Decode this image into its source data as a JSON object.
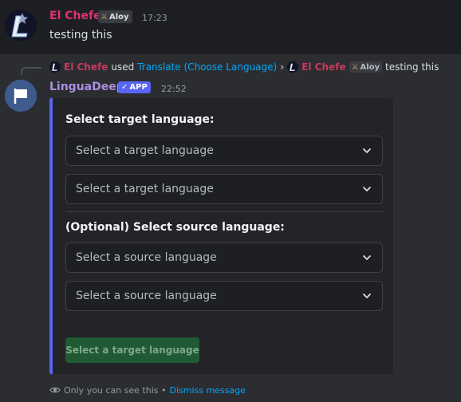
{
  "message": {
    "author": "El Chefe",
    "author_color": "#e0316e",
    "tag": "Aloy",
    "time": "17:23",
    "text": "testing this"
  },
  "reply": {
    "author": "El Chefe",
    "used_text": "used",
    "command": "Translate (Choose Language)",
    "separator": "›",
    "tag_author": "El Chefe",
    "tag": "Aloy",
    "text": "testing this"
  },
  "bot": {
    "name": "LinguaDeep",
    "name_color": "#a98fe0",
    "badge": "APP",
    "time": "22:52"
  },
  "embed": {
    "accent": "#5865f2",
    "target_title": "Select target language:",
    "target_selects": [
      {
        "placeholder": "Select a target language"
      },
      {
        "placeholder": "Select a target language"
      }
    ],
    "source_title": "(Optional) Select source language:",
    "source_selects": [
      {
        "placeholder": "Select a source language"
      },
      {
        "placeholder": "Select a source language"
      }
    ],
    "submit_label": "Select a target language",
    "submit_color": "#248046"
  },
  "footer": {
    "text": "Only you can see this •",
    "link": "Dismiss message"
  }
}
